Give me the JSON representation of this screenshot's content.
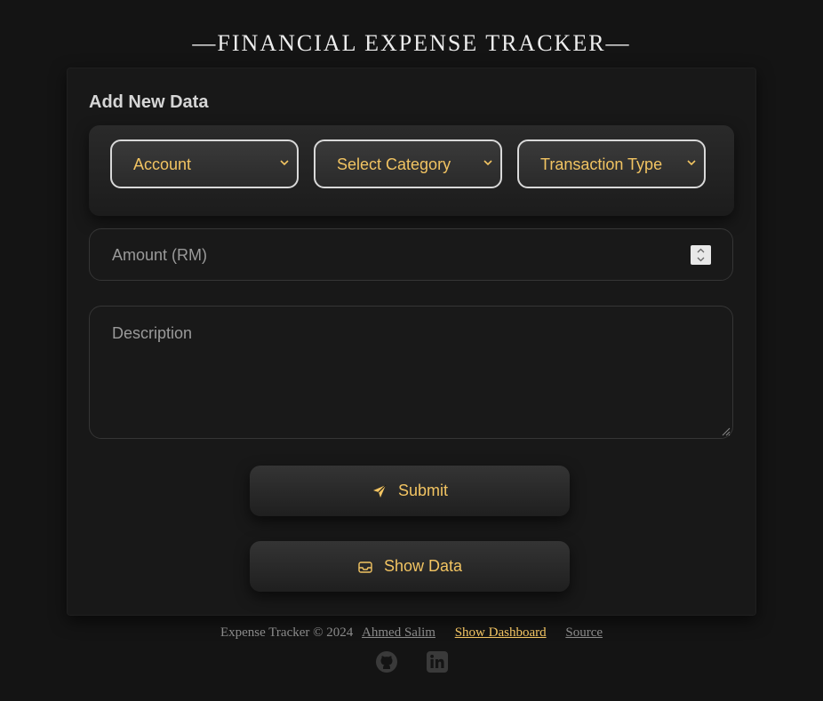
{
  "header": {
    "title": "—FINANCIAL EXPENSE TRACKER—"
  },
  "form": {
    "heading": "Add New Data",
    "selects": [
      {
        "label": "Account"
      },
      {
        "label": "Select Category"
      },
      {
        "label": "Transaction Type"
      }
    ],
    "amount_placeholder": "Amount (RM)",
    "description_placeholder": "Description",
    "submit_label": "Submit",
    "show_data_label": "Show Data"
  },
  "footer": {
    "copyright": "Expense Tracker © 2024",
    "author_link": "Ahmed Salim",
    "dashboard_link": "Show Dashboard",
    "source_link": "Source"
  },
  "icons": {
    "submit": "paper-plane-icon",
    "show_data": "inbox-icon",
    "social": [
      "github-icon",
      "linkedin-icon"
    ]
  },
  "colors": {
    "accent": "#f2c462",
    "background": "#141414",
    "card": "#181818"
  }
}
